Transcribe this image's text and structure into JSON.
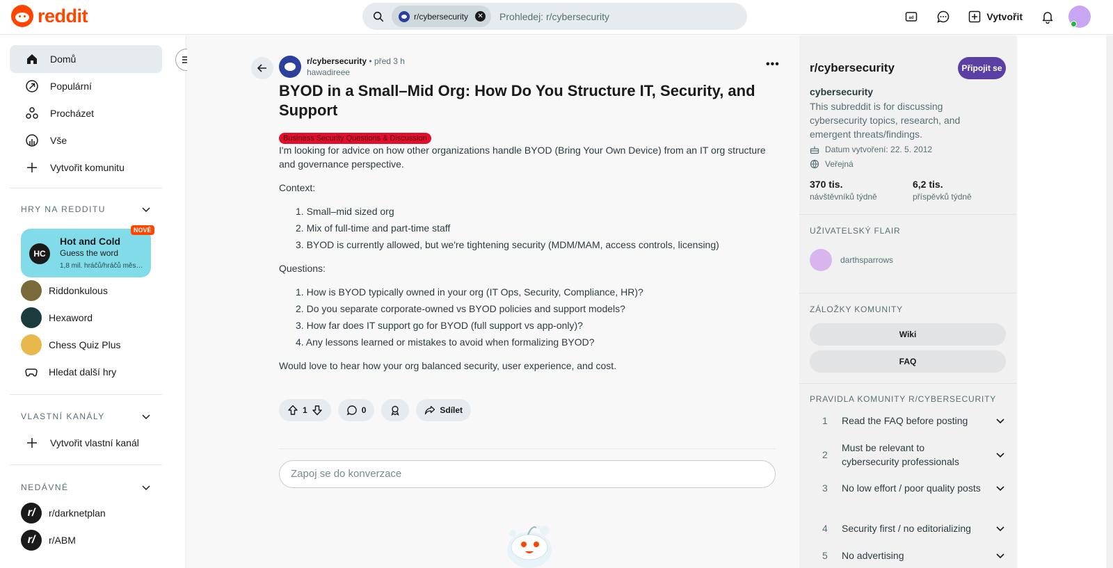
{
  "header": {
    "logo_text": "reddit",
    "search_chip": "r/cybersecurity",
    "search_placeholder": "Prohledej: r/cybersecurity",
    "create_label": "Vytvořit"
  },
  "left_nav": {
    "items": [
      {
        "label": "Domů",
        "icon": "home-icon"
      },
      {
        "label": "Populární",
        "icon": "popular-icon"
      },
      {
        "label": "Procházet",
        "icon": "explore-icon"
      },
      {
        "label": "Vše",
        "icon": "all-icon"
      },
      {
        "label": "Vytvořit komunitu",
        "icon": "plus-icon"
      }
    ],
    "games_header": "HRY NA REDDITU",
    "featured_game": {
      "title": "Hot and Cold",
      "subtitle": "Guess the word",
      "meta": "1,8 mil. hráčů/hráčů měs…",
      "badge": "NOVÉ"
    },
    "games": [
      {
        "label": "Riddonkulous"
      },
      {
        "label": "Hexaword"
      },
      {
        "label": "Chess Quiz Plus"
      },
      {
        "label": "Hledat další hry"
      }
    ],
    "custom_header": "VLASTNÍ KANÁLY",
    "custom_create": "Vytvořit vlastní kanál",
    "recent_header": "NEDÁVNÉ",
    "recent": [
      {
        "label": "r/darknetplan"
      },
      {
        "label": "r/ABM"
      }
    ]
  },
  "post": {
    "subreddit": "r/cybersecurity",
    "time": "• před 3 h",
    "author": "hawadireee",
    "title": "BYOD in a Small–Mid Org: How Do You Structure IT, Security, and Support",
    "flair": "Business Security Questions & Discussion",
    "intro": "I'm looking for advice on how other organizations handle BYOD (Bring Your Own Device) from an IT org structure and governance perspective.",
    "context_label": "Context:",
    "context_items": [
      "Small–mid sized org",
      "Mix of full-time and part-time staff",
      "BYOD is currently allowed, but we're tightening security (MDM/MAM, access controls, licensing)"
    ],
    "questions_label": "Questions:",
    "question_items": [
      "How is BYOD typically owned in your org (IT Ops, Security, Compliance, HR)?",
      "Do you separate corporate-owned vs BYOD policies and support models?",
      "How far does IT support go for BYOD (full support vs app-only)?",
      "Any lessons learned or mistakes to avoid when formalizing BYOD?"
    ],
    "outro": "Would love to hear how your org balanced security, user experience, and cost.",
    "votes": "1",
    "comments": "0",
    "share_label": "Sdílet",
    "comment_placeholder": "Zapoj se do konverzace"
  },
  "sidebar": {
    "title": "r/cybersecurity",
    "join_label": "Připojit se",
    "name": "cybersecurity",
    "description": "This subreddit is for discussing cybersecurity topics, research, and emergent threats/findings.",
    "created": "Datum vytvoření: 22. 5. 2012",
    "visibility": "Veřejná",
    "visitors_value": "370 tis.",
    "visitors_label": "návštěvníků týdně",
    "posts_value": "6,2 tis.",
    "posts_label": "příspěvků týdně",
    "user_flair_header": "UŽIVATELSKÝ FLAIR",
    "user_flair_name": "darthsparrows",
    "bookmarks_header": "ZÁLOŽKY KOMUNITY",
    "bookmarks": [
      "Wiki",
      "FAQ"
    ],
    "rules_header": "PRAVIDLA KOMUNITY R/CYBERSECURITY",
    "rules": [
      {
        "num": "1",
        "text": "Read the FAQ before posting"
      },
      {
        "num": "2",
        "text": "Must be relevant to cybersecurity professionals"
      },
      {
        "num": "3",
        "text": "No low effort / poor quality posts"
      },
      {
        "num": "4",
        "text": "Security first / no editorializing"
      },
      {
        "num": "5",
        "text": "No advertising"
      }
    ]
  },
  "colors": {
    "brand": "#ff4500",
    "join": "#5b3fa3",
    "flair": "#e0102c",
    "game_card": "#82dbe8"
  }
}
